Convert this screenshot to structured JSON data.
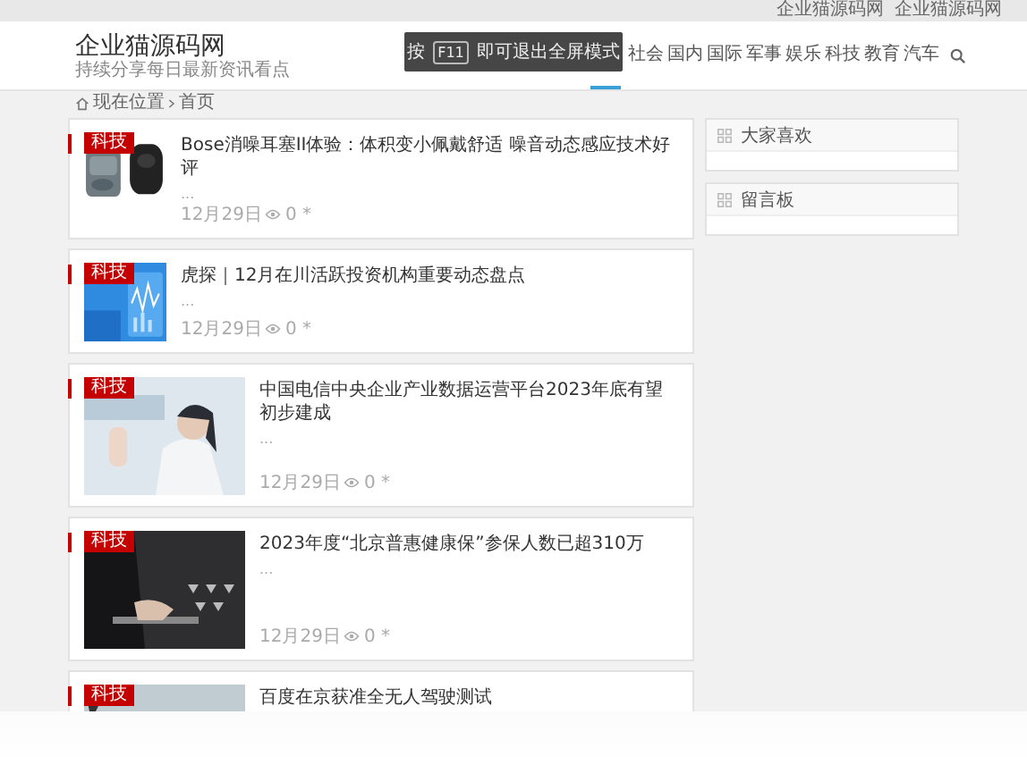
{
  "top_links": [
    "企业猫源码网",
    "企业猫源码网"
  ],
  "site": {
    "name": "企业猫源码网",
    "slogan": "持续分享每日最新资讯看点"
  },
  "nav": [
    {
      "label": "社会"
    },
    {
      "label": "国内"
    },
    {
      "label": "国际"
    },
    {
      "label": "军事"
    },
    {
      "label": "娱乐"
    },
    {
      "label": "科技"
    },
    {
      "label": "教育"
    },
    {
      "label": "汽车"
    }
  ],
  "fullscreen_notice": {
    "prefix": "按",
    "key": "F11",
    "suffix": "即可退出全屏模式"
  },
  "breadcrumb": {
    "label": "现在位置",
    "current": "首页"
  },
  "articles": [
    {
      "tag": "科技",
      "title": "Bose消噪耳塞II体验：体积变小佩戴舒适 噪音动态感应技术好评",
      "excerpt": "...",
      "date": "12月29日",
      "views": "0 *",
      "kind": "small"
    },
    {
      "tag": "科技",
      "title": "虎探｜12月在川活跃投资机构重要动态盘点",
      "excerpt": "...",
      "date": "12月29日",
      "views": "0 *",
      "kind": "small"
    },
    {
      "tag": "科技",
      "title": "中国电信中央企业产业数据运营平台2023年底有望初步建成",
      "excerpt": "...",
      "date": "12月29日",
      "views": "0 *",
      "kind": "large"
    },
    {
      "tag": "科技",
      "title": "2023年度“北京普惠健康保”参保人数已超310万",
      "excerpt": "...",
      "date": "12月29日",
      "views": "0 *",
      "kind": "large"
    },
    {
      "tag": "科技",
      "title": "百度在京获准全无人驾驶测试",
      "kind": "large"
    }
  ],
  "sidebar": [
    {
      "title": "大家喜欢"
    },
    {
      "title": "留言板"
    }
  ]
}
